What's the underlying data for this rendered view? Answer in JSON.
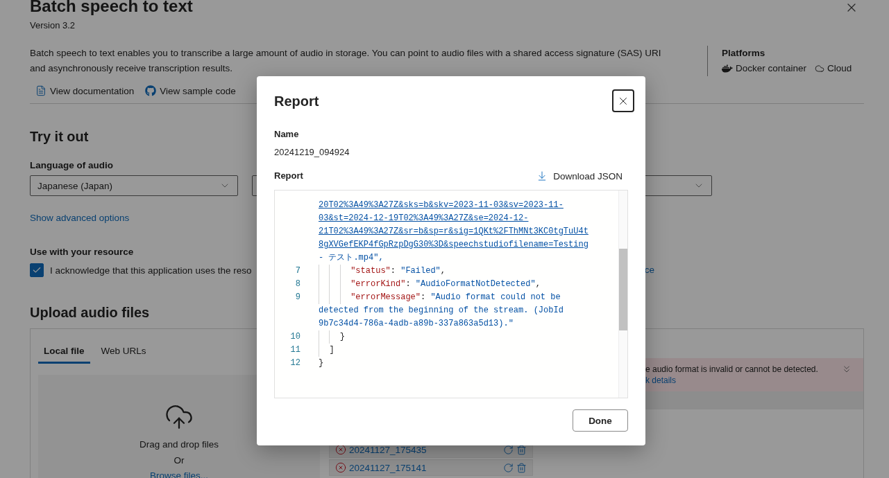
{
  "page": {
    "title": "Batch speech to text",
    "version": "Version 3.2",
    "description": "Batch speech to text enables you to transcribe a large amount of audio in storage. You can point to audio files with a shared access signature (SAS) URI and asynchronously receive transcription results.",
    "platforms": {
      "heading": "Platforms",
      "items": [
        {
          "kind": "docker",
          "label": "Docker container"
        },
        {
          "kind": "cloud",
          "label": "Cloud"
        }
      ]
    },
    "links": [
      {
        "kind": "doc",
        "label": "View documentation"
      },
      {
        "kind": "github",
        "label": "View sample code"
      }
    ]
  },
  "try_it_out": {
    "heading": "Try it out",
    "fields": [
      {
        "label": "Language of audio",
        "value": "Japanese (Japan)"
      }
    ],
    "advanced_link": "Show advanced options"
  },
  "resource": {
    "heading": "Use with your resource",
    "checked": true,
    "text": "I acknowledge that this application uses the reso",
    "link": "ce"
  },
  "upload": {
    "heading": "Upload audio files",
    "tabs": [
      {
        "label": "Local file",
        "selected": true
      },
      {
        "label": "Web URLs",
        "selected": false
      }
    ],
    "dropzone": {
      "text": "Drag and drop files",
      "or": "Or",
      "browse": "Browse files..."
    },
    "files": [
      {
        "name": "20241127_175435",
        "failed": true
      },
      {
        "name": "20241127_175141",
        "failed": true
      }
    ],
    "banner": {
      "message": "e audio format is invalid or cannot be detected.",
      "link": "k details"
    }
  },
  "dialog": {
    "title": "Report",
    "name_label": "Name",
    "name": "20241219_094924",
    "report_label": "Report",
    "download": "Download JSON",
    "done": "Done",
    "lines": [
      {
        "segments": [
          {
            "kind": "link",
            "text": "20T02%3A49%3A27Z&sks=b&skv=2023-11-03&sv=2023-11-"
          }
        ]
      },
      {
        "segments": [
          {
            "kind": "link",
            "text": "03&st=2024-12-19T02%3A49%3A27Z&se=2024-12-"
          }
        ]
      },
      {
        "segments": [
          {
            "kind": "link",
            "text": "21T02%3A49%3A27Z&sr=b&sp=r&sig=1QKt%2FThMNt3KC0tgTuU4t"
          }
        ]
      },
      {
        "segments": [
          {
            "kind": "link",
            "text": "8gXVGefEKP4fGpRzpDgG30%3D&speechstudiofilename=Testing"
          }
        ]
      },
      {
        "segments": [
          {
            "kind": "string",
            "text": "- テスト.mp4\","
          }
        ]
      },
      {
        "number": "7",
        "segments": [
          {
            "kind": "guide"
          },
          {
            "kind": "guide"
          },
          {
            "kind": "guide"
          },
          {
            "kind": "key",
            "text": "\"status\""
          },
          {
            "kind": "punct",
            "text": ": "
          },
          {
            "kind": "string",
            "text": "\"Failed\""
          },
          {
            "kind": "punct",
            "text": ","
          }
        ]
      },
      {
        "number": "8",
        "segments": [
          {
            "kind": "guide"
          },
          {
            "kind": "guide"
          },
          {
            "kind": "guide"
          },
          {
            "kind": "key",
            "text": "\"errorKind\""
          },
          {
            "kind": "punct",
            "text": ": "
          },
          {
            "kind": "string",
            "text": "\"AudioFormatNotDetected\""
          },
          {
            "kind": "punct",
            "text": ","
          }
        ]
      },
      {
        "number": "9",
        "segments": [
          {
            "kind": "guide"
          },
          {
            "kind": "guide"
          },
          {
            "kind": "guide"
          },
          {
            "kind": "key",
            "text": "\"errorMessage\""
          },
          {
            "kind": "punct",
            "text": ": "
          },
          {
            "kind": "string",
            "text": "\"Audio format could not be"
          }
        ]
      },
      {
        "segments": [
          {
            "kind": "string",
            "text": "detected from the beginning of the stream. (JobId"
          }
        ]
      },
      {
        "segments": [
          {
            "kind": "string",
            "text": "9b7c34d4-786a-4adb-a89b-337a863a5d13).\""
          }
        ]
      },
      {
        "number": "10",
        "segments": [
          {
            "kind": "guide"
          },
          {
            "kind": "guide"
          },
          {
            "kind": "punct",
            "text": "}"
          }
        ]
      },
      {
        "number": "11",
        "segments": [
          {
            "kind": "guide"
          },
          {
            "kind": "punct",
            "text": "]"
          }
        ]
      },
      {
        "number": "12",
        "segments": [
          {
            "kind": "punct",
            "text": "}"
          }
        ]
      }
    ]
  }
}
